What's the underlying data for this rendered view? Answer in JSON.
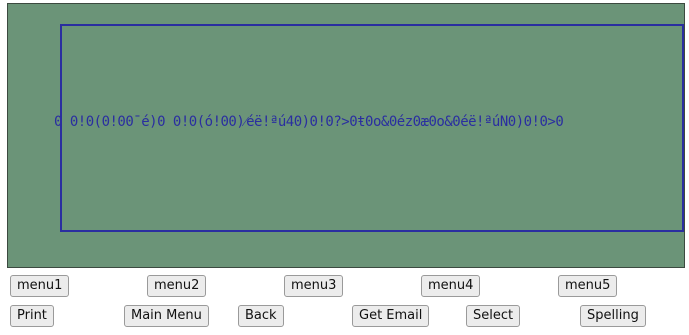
{
  "display": {
    "text": "0 0!0(0!00¯é)0 0!0(ó!00)⁄éë!ªú40)0!0?>0ŧ0o&0éz0æ0o&0éë!ªúN0)0!0>0"
  },
  "menu_row": {
    "buttons": [
      "menu1",
      "menu2",
      "menu3",
      "menu4",
      "menu5"
    ]
  },
  "action_row": {
    "buttons": [
      "Print",
      "Main Menu",
      "Back",
      "Get Email",
      "Select",
      "Spelling"
    ]
  },
  "colors": {
    "screen_bg": "#6b9478",
    "frame": "#2a2ea0"
  }
}
